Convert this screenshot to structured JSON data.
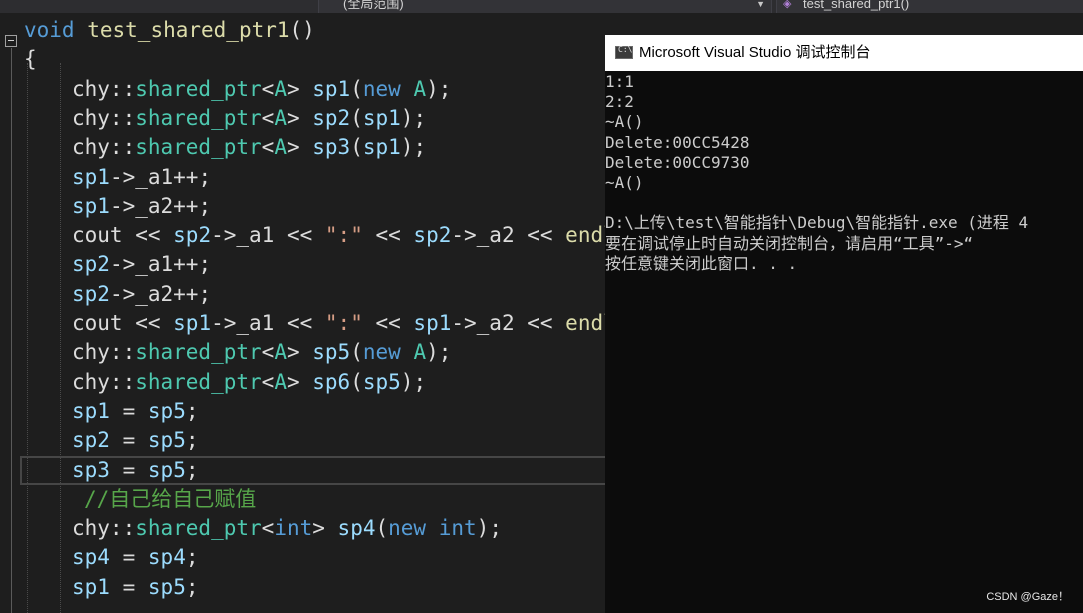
{
  "navbar": {
    "scope": "(全局范围)",
    "function": "test_shared_ptr1()"
  },
  "code_lines": [
    [
      [
        "k",
        "void"
      ],
      [
        "t",
        " "
      ],
      [
        "f",
        "test_shared_ptr1"
      ],
      [
        "t",
        "()"
      ]
    ],
    [
      [
        "t",
        "{"
      ]
    ],
    [
      [
        "t",
        "chy::"
      ],
      [
        "ty",
        "shared_ptr"
      ],
      [
        "t",
        "<"
      ],
      [
        "ty",
        "A"
      ],
      [
        "t",
        "> "
      ],
      [
        "v",
        "sp1"
      ],
      [
        "t",
        "("
      ],
      [
        "k",
        "new"
      ],
      [
        "t",
        " "
      ],
      [
        "ty",
        "A"
      ],
      [
        "t",
        ");"
      ]
    ],
    [
      [
        "t",
        "chy::"
      ],
      [
        "ty",
        "shared_ptr"
      ],
      [
        "t",
        "<"
      ],
      [
        "ty",
        "A"
      ],
      [
        "t",
        "> "
      ],
      [
        "v",
        "sp2"
      ],
      [
        "t",
        "("
      ],
      [
        "v",
        "sp1"
      ],
      [
        "t",
        ");"
      ]
    ],
    [
      [
        "t",
        "chy::"
      ],
      [
        "ty",
        "shared_ptr"
      ],
      [
        "t",
        "<"
      ],
      [
        "ty",
        "A"
      ],
      [
        "t",
        "> "
      ],
      [
        "v",
        "sp3"
      ],
      [
        "t",
        "("
      ],
      [
        "v",
        "sp1"
      ],
      [
        "t",
        ");"
      ]
    ],
    [
      [
        "v",
        "sp1"
      ],
      [
        "t",
        "->"
      ],
      [
        "t",
        "_a1++;"
      ]
    ],
    [
      [
        "v",
        "sp1"
      ],
      [
        "t",
        "->"
      ],
      [
        "t",
        "_a2++;"
      ]
    ],
    [
      [
        "t",
        "cout "
      ],
      [
        "t",
        "<< "
      ],
      [
        "v",
        "sp2"
      ],
      [
        "t",
        "->"
      ],
      [
        "t",
        "_a1 "
      ],
      [
        "t",
        "<< "
      ],
      [
        "s",
        "\":\""
      ],
      [
        "t",
        " << "
      ],
      [
        "v",
        "sp2"
      ],
      [
        "t",
        "->"
      ],
      [
        "t",
        "_a2 "
      ],
      [
        "t",
        "<< "
      ],
      [
        "f",
        "endl"
      ],
      [
        "t",
        ";"
      ]
    ],
    [
      [
        "v",
        "sp2"
      ],
      [
        "t",
        "->"
      ],
      [
        "t",
        "_a1++;"
      ]
    ],
    [
      [
        "v",
        "sp2"
      ],
      [
        "t",
        "->"
      ],
      [
        "t",
        "_a2++;"
      ]
    ],
    [
      [
        "t",
        "cout "
      ],
      [
        "t",
        "<< "
      ],
      [
        "v",
        "sp1"
      ],
      [
        "t",
        "->"
      ],
      [
        "t",
        "_a1 "
      ],
      [
        "t",
        "<< "
      ],
      [
        "s",
        "\":\""
      ],
      [
        "t",
        " << "
      ],
      [
        "v",
        "sp1"
      ],
      [
        "t",
        "->"
      ],
      [
        "t",
        "_a2 "
      ],
      [
        "t",
        "<< "
      ],
      [
        "f",
        "endl"
      ],
      [
        "t",
        ";"
      ]
    ],
    [
      [
        "t",
        "chy::"
      ],
      [
        "ty",
        "shared_ptr"
      ],
      [
        "t",
        "<"
      ],
      [
        "ty",
        "A"
      ],
      [
        "t",
        "> "
      ],
      [
        "v",
        "sp5"
      ],
      [
        "t",
        "("
      ],
      [
        "k",
        "new"
      ],
      [
        "t",
        " "
      ],
      [
        "ty",
        "A"
      ],
      [
        "t",
        ");"
      ]
    ],
    [
      [
        "t",
        "chy::"
      ],
      [
        "ty",
        "shared_ptr"
      ],
      [
        "t",
        "<"
      ],
      [
        "ty",
        "A"
      ],
      [
        "t",
        "> "
      ],
      [
        "v",
        "sp6"
      ],
      [
        "t",
        "("
      ],
      [
        "v",
        "sp5"
      ],
      [
        "t",
        ");"
      ]
    ],
    [
      [
        "v",
        "sp1"
      ],
      [
        "t",
        " "
      ],
      [
        "m",
        "="
      ],
      [
        "t",
        " "
      ],
      [
        "v",
        "sp5"
      ],
      [
        "t",
        ";"
      ]
    ],
    [
      [
        "v",
        "sp2"
      ],
      [
        "t",
        " "
      ],
      [
        "m",
        "="
      ],
      [
        "t",
        " "
      ],
      [
        "v",
        "sp5"
      ],
      [
        "t",
        ";"
      ]
    ],
    [
      [
        "v",
        "sp3"
      ],
      [
        "t",
        " "
      ],
      [
        "m",
        "="
      ],
      [
        "t",
        " "
      ],
      [
        "v",
        "sp5"
      ],
      [
        "t",
        ";"
      ]
    ],
    [
      [
        "c",
        "//自己给自己赋值"
      ]
    ],
    [
      [
        "t",
        "chy::"
      ],
      [
        "ty",
        "shared_ptr"
      ],
      [
        "t",
        "<"
      ],
      [
        "k",
        "int"
      ],
      [
        "t",
        "> "
      ],
      [
        "v",
        "sp4"
      ],
      [
        "t",
        "("
      ],
      [
        "k",
        "new"
      ],
      [
        "t",
        " "
      ],
      [
        "k",
        "int"
      ],
      [
        "t",
        ");"
      ]
    ],
    [
      [
        "v",
        "sp4"
      ],
      [
        "t",
        " "
      ],
      [
        "m",
        "="
      ],
      [
        "t",
        " "
      ],
      [
        "v",
        "sp4"
      ],
      [
        "t",
        ";"
      ]
    ],
    [
      [
        "v",
        "sp1"
      ],
      [
        "t",
        " "
      ],
      [
        "m",
        "="
      ],
      [
        "t",
        " "
      ],
      [
        "v",
        "sp5"
      ],
      [
        "t",
        ";"
      ]
    ]
  ],
  "console": {
    "title": "Microsoft Visual Studio 调试控制台",
    "icon_text": "C:\\",
    "lines": [
      "1:1",
      "2:2",
      "~A()",
      "Delete:00CC5428",
      "Delete:00CC9730",
      "~A()",
      "",
      "D:\\上传\\test\\智能指针\\Debug\\智能指针.exe (进程 4",
      "要在调试停止时自动关闭控制台，请启用“工具”->“",
      "按任意键关闭此窗口. . ."
    ]
  },
  "watermark": "CSDN @Gaze！",
  "colors": {
    "editor_bg": "#1e1e1e",
    "keyword": "#569cd6",
    "function": "#dcdcaa",
    "variable": "#9cdcfe",
    "type": "#4ec9b0",
    "string": "#d69d85",
    "comment": "#57a64a",
    "console_bg": "#0c0c0c"
  }
}
